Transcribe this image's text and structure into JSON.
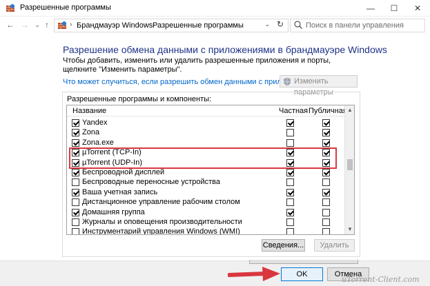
{
  "window": {
    "title": "Разрешенные программы",
    "min_glyph": "—",
    "max_glyph": "☐",
    "close_glyph": "✕"
  },
  "nav": {
    "back_glyph": "←",
    "forward_glyph": "→",
    "recent_glyph": "⌄",
    "up_glyph": "↑",
    "refresh_glyph": "↻",
    "breadcrumb": [
      "Брандмауэр Windows",
      "Разрешенные программы"
    ],
    "breadcrumb_sep": "›",
    "dropdown_glyph": "⌄",
    "search_placeholder": "Поиск в панели управления"
  },
  "main": {
    "heading": "Разрешение обмена данными с приложениями в брандмауэре Windows",
    "description": "Чтобы добавить, изменить или удалить разрешенные приложения и порты, щелкните \"Изменить параметры\".",
    "risk_link": "Что может случиться, если разрешить обмен данными с приложением?",
    "change_settings_label": "Изменить параметры"
  },
  "group": {
    "caption": "Разрешенные программы и компоненты:",
    "columns": {
      "name": "Название",
      "private": "Частная",
      "public": "Публичная"
    },
    "scroll_up_glyph": "▲",
    "scroll_down_glyph": "▼",
    "rows": [
      {
        "name": "Yandex",
        "enabled": true,
        "private": true,
        "public": true
      },
      {
        "name": "Zona",
        "enabled": true,
        "private": false,
        "public": true
      },
      {
        "name": "Zona.exe",
        "enabled": true,
        "private": false,
        "public": true
      },
      {
        "name": "µTorrent (TCP-In)",
        "enabled": true,
        "private": true,
        "public": true
      },
      {
        "name": "µTorrent (UDP-In)",
        "enabled": true,
        "private": true,
        "public": true
      },
      {
        "name": "Беспроводной дисплей",
        "enabled": true,
        "private": true,
        "public": true
      },
      {
        "name": "Беспроводные переносные устройства",
        "enabled": false,
        "private": false,
        "public": false
      },
      {
        "name": "Ваша учетная запись",
        "enabled": true,
        "private": true,
        "public": true
      },
      {
        "name": "Дистанционное управление рабочим столом",
        "enabled": false,
        "private": false,
        "public": false
      },
      {
        "name": "Домашняя группа",
        "enabled": true,
        "private": true,
        "public": false
      },
      {
        "name": "Журналы и оповещения производительности",
        "enabled": false,
        "private": false,
        "public": false
      },
      {
        "name": "Инструментарий управления Windows (WMI)",
        "enabled": false,
        "private": false,
        "public": false
      }
    ],
    "details_label": "Сведения...",
    "delete_label": "Удалить"
  },
  "footer": {
    "ok_label": "OK",
    "cancel_label": "Отмена"
  },
  "watermark": "uTorrent-Client.com",
  "colors": {
    "heading": "#1e3287",
    "link": "#0066cc",
    "highlight": "#d9373f",
    "arrow": "#d9373f"
  }
}
